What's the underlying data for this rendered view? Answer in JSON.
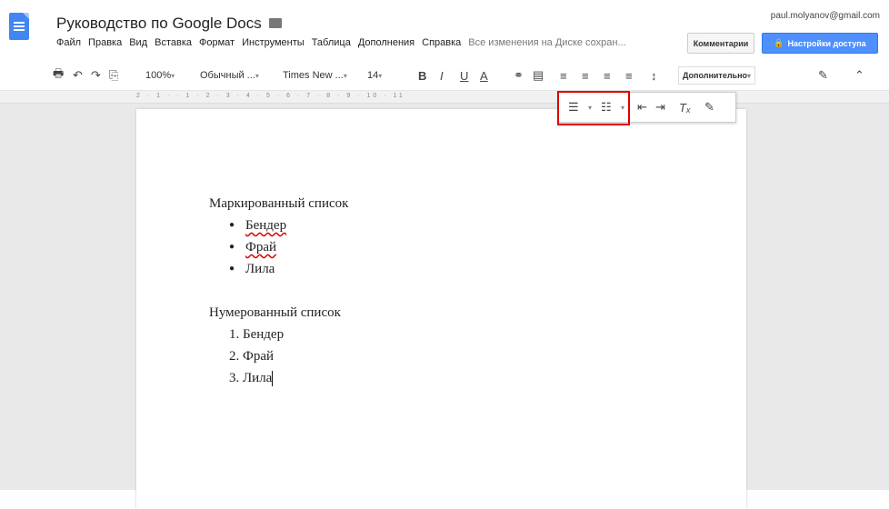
{
  "app": {
    "doc_title": "Руководство по Google Docs",
    "account": "paul.molyanov@gmail.com"
  },
  "menu": [
    "Файл",
    "Правка",
    "Вид",
    "Вставка",
    "Формат",
    "Инструменты",
    "Таблица",
    "Дополнения",
    "Справка"
  ],
  "save_status": "Все изменения на Диске сохран...",
  "buttons": {
    "comments": "Комментарии",
    "share": "Настройки доступа"
  },
  "toolbar": {
    "zoom": "100%",
    "style": "Обычный ...",
    "font": "Times New ...",
    "size": "14",
    "more": "Дополнительно"
  },
  "ruler": "2 · 1 · · 1 · 2 · 3 · 4 · 5 · 6 · 7 · 8 · 9 · 10 · 11",
  "document": {
    "bullet_heading": "Маркированный список",
    "bullet_items": [
      "Бендер",
      "Фрай",
      "Лила"
    ],
    "number_heading": "Нумерованный список",
    "number_items": [
      "1. Бендер",
      "2. Фрай",
      "3. Лила"
    ]
  }
}
